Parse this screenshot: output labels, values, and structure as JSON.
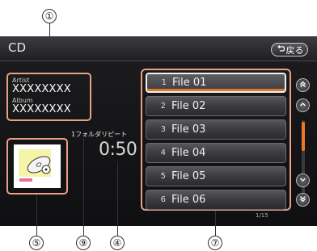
{
  "screen": {
    "title": "CD",
    "back_button_label": "戻る",
    "back_icon": "return-arrow-icon"
  },
  "info": {
    "artist_label": "Artist",
    "artist_value": "XXXXXXXX",
    "album_label": "Album",
    "album_value": "XXXXXXXX"
  },
  "playback": {
    "repeat_mode": "1フォルダリピート",
    "elapsed_time": "0:50"
  },
  "file_list": {
    "items": [
      {
        "number": "1",
        "name": "File 01",
        "selected": true
      },
      {
        "number": "2",
        "name": "File 02",
        "selected": false
      },
      {
        "number": "3",
        "name": "File 03",
        "selected": false
      },
      {
        "number": "4",
        "name": "File 04",
        "selected": false
      },
      {
        "number": "5",
        "name": "File 05",
        "selected": false
      },
      {
        "number": "6",
        "name": "File 06",
        "selected": false
      }
    ],
    "page_indicator": "1/15"
  },
  "scroll": {
    "page_up_icon": "double-chevron-up-icon",
    "up_icon": "chevron-up-icon",
    "down_icon": "chevron-down-icon",
    "page_down_icon": "double-chevron-down-icon"
  },
  "callouts": [
    "①",
    "⑤",
    "⑨",
    "④",
    "⑦"
  ],
  "colors": {
    "highlight_frame": "#e9a183",
    "accent_orange": "#e9782d",
    "screen_bg": "#141416"
  }
}
